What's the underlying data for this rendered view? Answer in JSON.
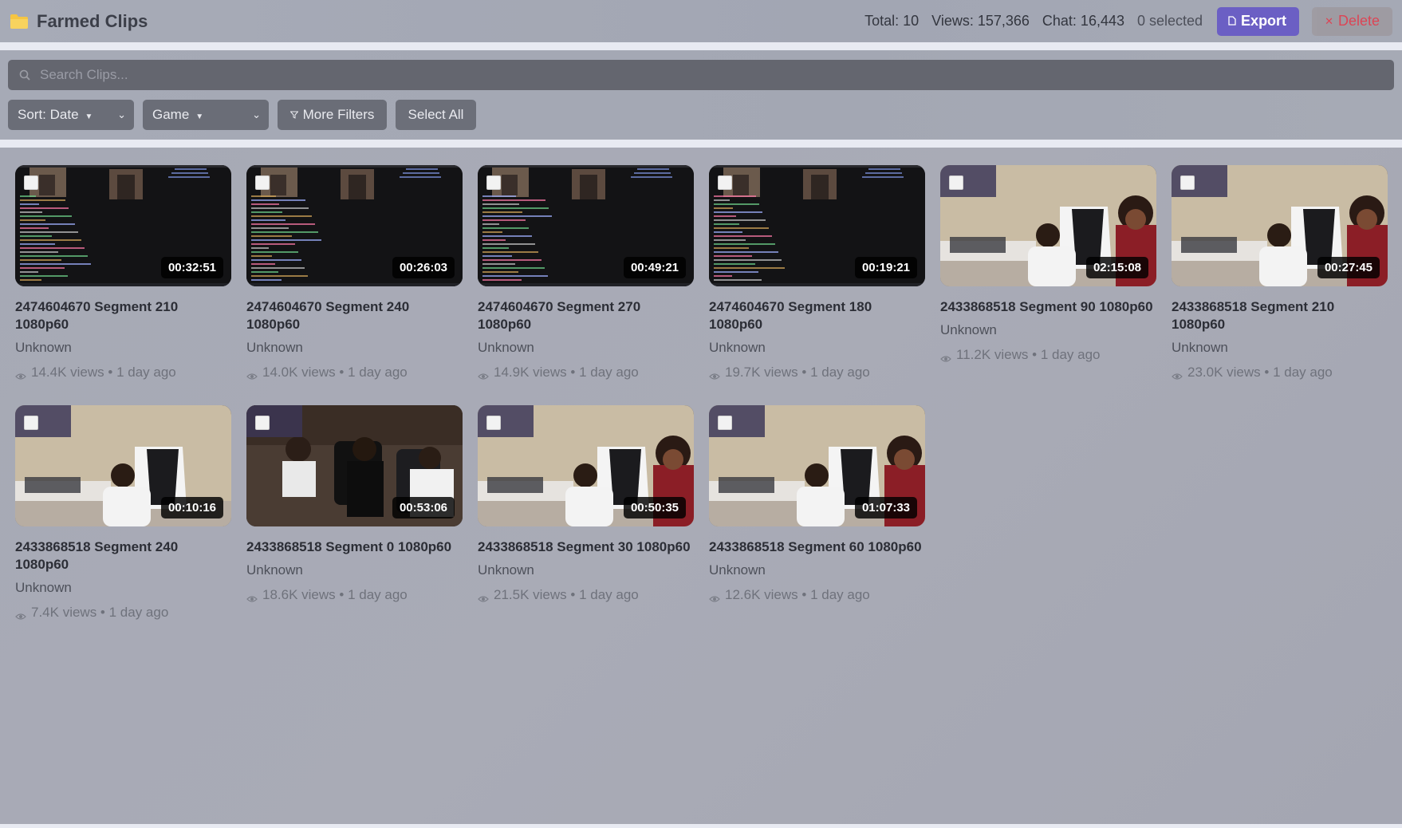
{
  "header": {
    "title": "Farmed Clips",
    "stats": {
      "total": "Total: 10",
      "views": "Views: 157,366",
      "chat": "Chat: 16,443",
      "selected": "0 selected"
    },
    "export_label": "Export",
    "delete_label": "Delete"
  },
  "search": {
    "placeholder": "Search Clips..."
  },
  "filters": {
    "sort_label": "Sort: Date",
    "game_label": "Game",
    "more_filters_label": "More Filters",
    "select_all_label": "Select All"
  },
  "clips": [
    {
      "title": "2474604670 Segment 210 1080p60",
      "category": "Unknown",
      "views": "14.4K views",
      "age": "1 day ago",
      "duration": "00:32:51",
      "thumb": "chat"
    },
    {
      "title": "2474604670 Segment 240 1080p60",
      "category": "Unknown",
      "views": "14.0K views",
      "age": "1 day ago",
      "duration": "00:26:03",
      "thumb": "chat"
    },
    {
      "title": "2474604670 Segment 270 1080p60",
      "category": "Unknown",
      "views": "14.9K views",
      "age": "1 day ago",
      "duration": "00:49:21",
      "thumb": "chat"
    },
    {
      "title": "2474604670 Segment 180 1080p60",
      "category": "Unknown",
      "views": "19.7K views",
      "age": "1 day ago",
      "duration": "00:19:21",
      "thumb": "chat"
    },
    {
      "title": "2433868518 Segment 90 1080p60",
      "category": "Unknown",
      "views": "11.2K views",
      "age": "1 day ago",
      "duration": "02:15:08",
      "thumb": "room"
    },
    {
      "title": "2433868518 Segment 210 1080p60",
      "category": "Unknown",
      "views": "23.0K views",
      "age": "1 day ago",
      "duration": "00:27:45",
      "thumb": "room"
    },
    {
      "title": "2433868518 Segment 240 1080p60",
      "category": "Unknown",
      "views": "7.4K views",
      "age": "1 day ago",
      "duration": "00:10:16",
      "thumb": "room"
    },
    {
      "title": "2433868518 Segment 0 1080p60",
      "category": "Unknown",
      "views": "18.6K views",
      "age": "1 day ago",
      "duration": "00:53:06",
      "thumb": "group"
    },
    {
      "title": "2433868518 Segment 30 1080p60",
      "category": "Unknown",
      "views": "21.5K views",
      "age": "1 day ago",
      "duration": "00:50:35",
      "thumb": "room"
    },
    {
      "title": "2433868518 Segment 60 1080p60",
      "category": "Unknown",
      "views": "12.6K views",
      "age": "1 day ago",
      "duration": "01:07:33",
      "thumb": "room"
    }
  ],
  "colors": {
    "accent": "#6b5fc4",
    "danger": "#e23b4b",
    "folder": "#f5c542"
  }
}
